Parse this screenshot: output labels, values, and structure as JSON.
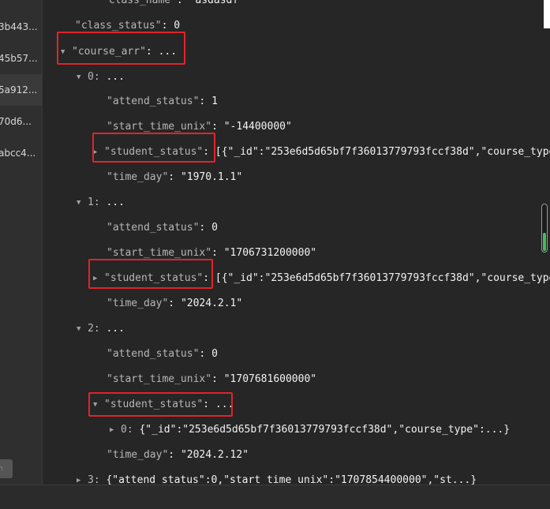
{
  "sidebar": {
    "items": [
      {
        "label": "3b443..."
      },
      {
        "label": "45b57..."
      },
      {
        "label": "5a912...",
        "selected": true
      },
      {
        "label": "70d6..."
      },
      {
        "label": "abcc4..."
      }
    ],
    "bottom_button": "n"
  },
  "tree": {
    "class_name_key": "\"class_name\"",
    "class_name_val": "\"asdasdf\"",
    "class_status_key": "\"class_status\"",
    "class_status_val": "0",
    "course_arr_key": "\"course_arr\"",
    "ellipsis": "...",
    "colon": ":",
    "items": [
      {
        "index": "0:",
        "attend_status_key": "\"attend_status\"",
        "attend_status_val": "1",
        "start_time_unix_key": "\"start_time_unix\"",
        "start_time_unix_val": "\"-14400000\"",
        "student_status_key": "\"student_status\"",
        "student_status_val": "[{\"_id\":\"253e6d5d65bf7f36013779793fccf38d\",\"course_type",
        "time_day_key": "\"time_day\"",
        "time_day_val": "\"1970.1.1\""
      },
      {
        "index": "1:",
        "attend_status_key": "\"attend_status\"",
        "attend_status_val": "0",
        "start_time_unix_key": "\"start_time_unix\"",
        "start_time_unix_val": "\"1706731200000\"",
        "student_status_key": "\"student_status\"",
        "student_status_val": "[{\"_id\":\"253e6d5d65bf7f36013779793fccf38d\",\"course_type",
        "time_day_key": "\"time_day\"",
        "time_day_val": "\"2024.2.1\""
      },
      {
        "index": "2:",
        "attend_status_key": "\"attend_status\"",
        "attend_status_val": "0",
        "start_time_unix_key": "\"start_time_unix\"",
        "start_time_unix_val": "\"1707681600000\"",
        "student_status_key": "\"student_status\"",
        "student_status_child_index": "0:",
        "student_status_child_val": "{\"_id\":\"253e6d5d65bf7f36013779793fccf38d\",\"course_type\":...}",
        "time_day_key": "\"time_day\"",
        "time_day_val": "\"2024.2.12\""
      },
      {
        "index": "3:",
        "summary": "{\"attend_status\":0,\"start_time_unix\":\"1707854400000\",\"st...}"
      }
    ]
  },
  "scroll": {
    "level": 0.4
  },
  "colors": {
    "background": "#262626",
    "key": "#b7b7b7",
    "value": "#f2f2f2",
    "highlight": "#e0242a",
    "scroll_fill": "#3cc05a"
  },
  "icons": {
    "expanded": "triangle-down-icon",
    "collapsed": "triangle-right-icon"
  }
}
